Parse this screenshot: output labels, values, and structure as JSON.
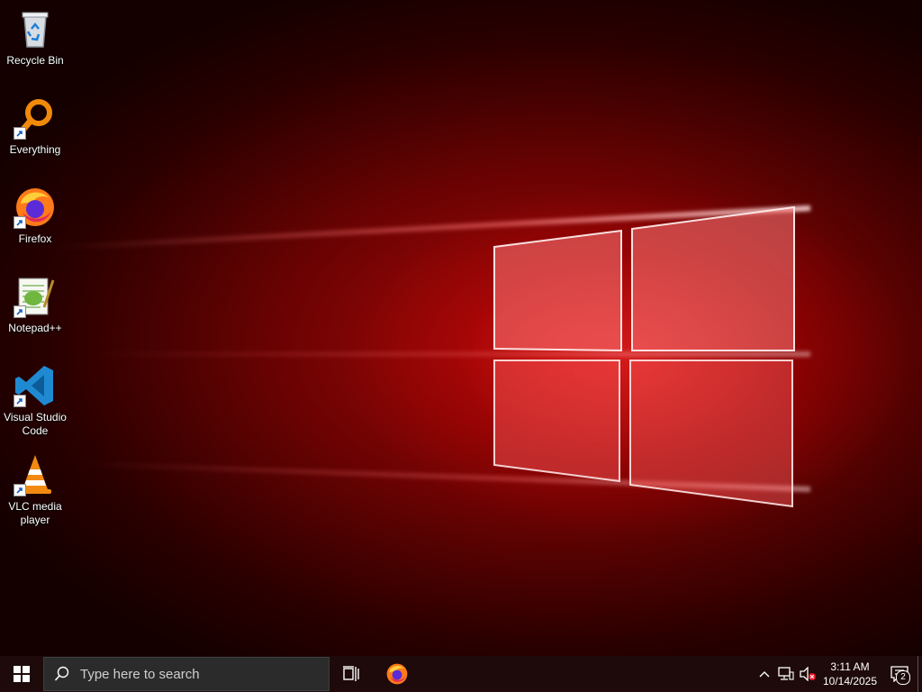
{
  "desktop": {
    "icons": [
      {
        "label": "Recycle Bin",
        "icon": "recycle-bin-icon",
        "shortcut": false
      },
      {
        "label": "Everything",
        "icon": "everything-search-icon",
        "shortcut": true
      },
      {
        "label": "Firefox",
        "icon": "firefox-icon",
        "shortcut": true
      },
      {
        "label": "Notepad++",
        "icon": "notepad-plus-plus-icon",
        "shortcut": true
      },
      {
        "label": "Visual Studio Code",
        "icon": "vscode-icon",
        "shortcut": true
      },
      {
        "label": "VLC media player",
        "icon": "vlc-icon",
        "shortcut": true
      }
    ]
  },
  "taskbar": {
    "search_placeholder": "Type here to search",
    "pinned": [
      "task-view-icon",
      "firefox-icon"
    ],
    "tray": {
      "time": "3:11 AM",
      "date": "10/14/2025",
      "notification_count": "2",
      "icons": [
        "chevron-up-icon",
        "network-icon",
        "volume-muted-icon"
      ]
    }
  },
  "colors": {
    "accent": "#e01010",
    "taskbar_bg": "#1e0a0a"
  }
}
